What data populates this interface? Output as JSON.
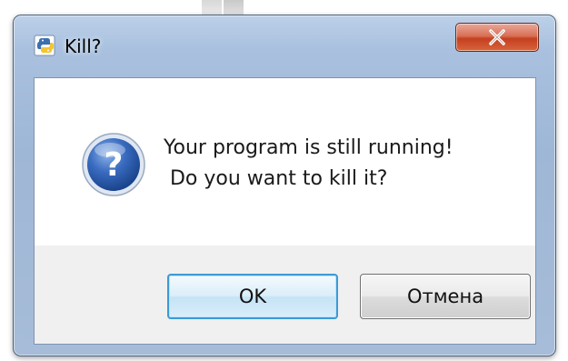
{
  "dialog": {
    "title": "Kill?",
    "message_line1": "Your program is still running!",
    "message_line2": " Do you want to kill it?",
    "ok_label": "OK",
    "cancel_label": "Отмена",
    "close_glyph": "✕"
  },
  "icons": {
    "title": "python-icon",
    "message": "question-icon",
    "close": "close-icon"
  },
  "colors": {
    "close_button": "#c9472a",
    "focus_border": "#3c9ad6",
    "question_icon": "#2b5aa8"
  }
}
